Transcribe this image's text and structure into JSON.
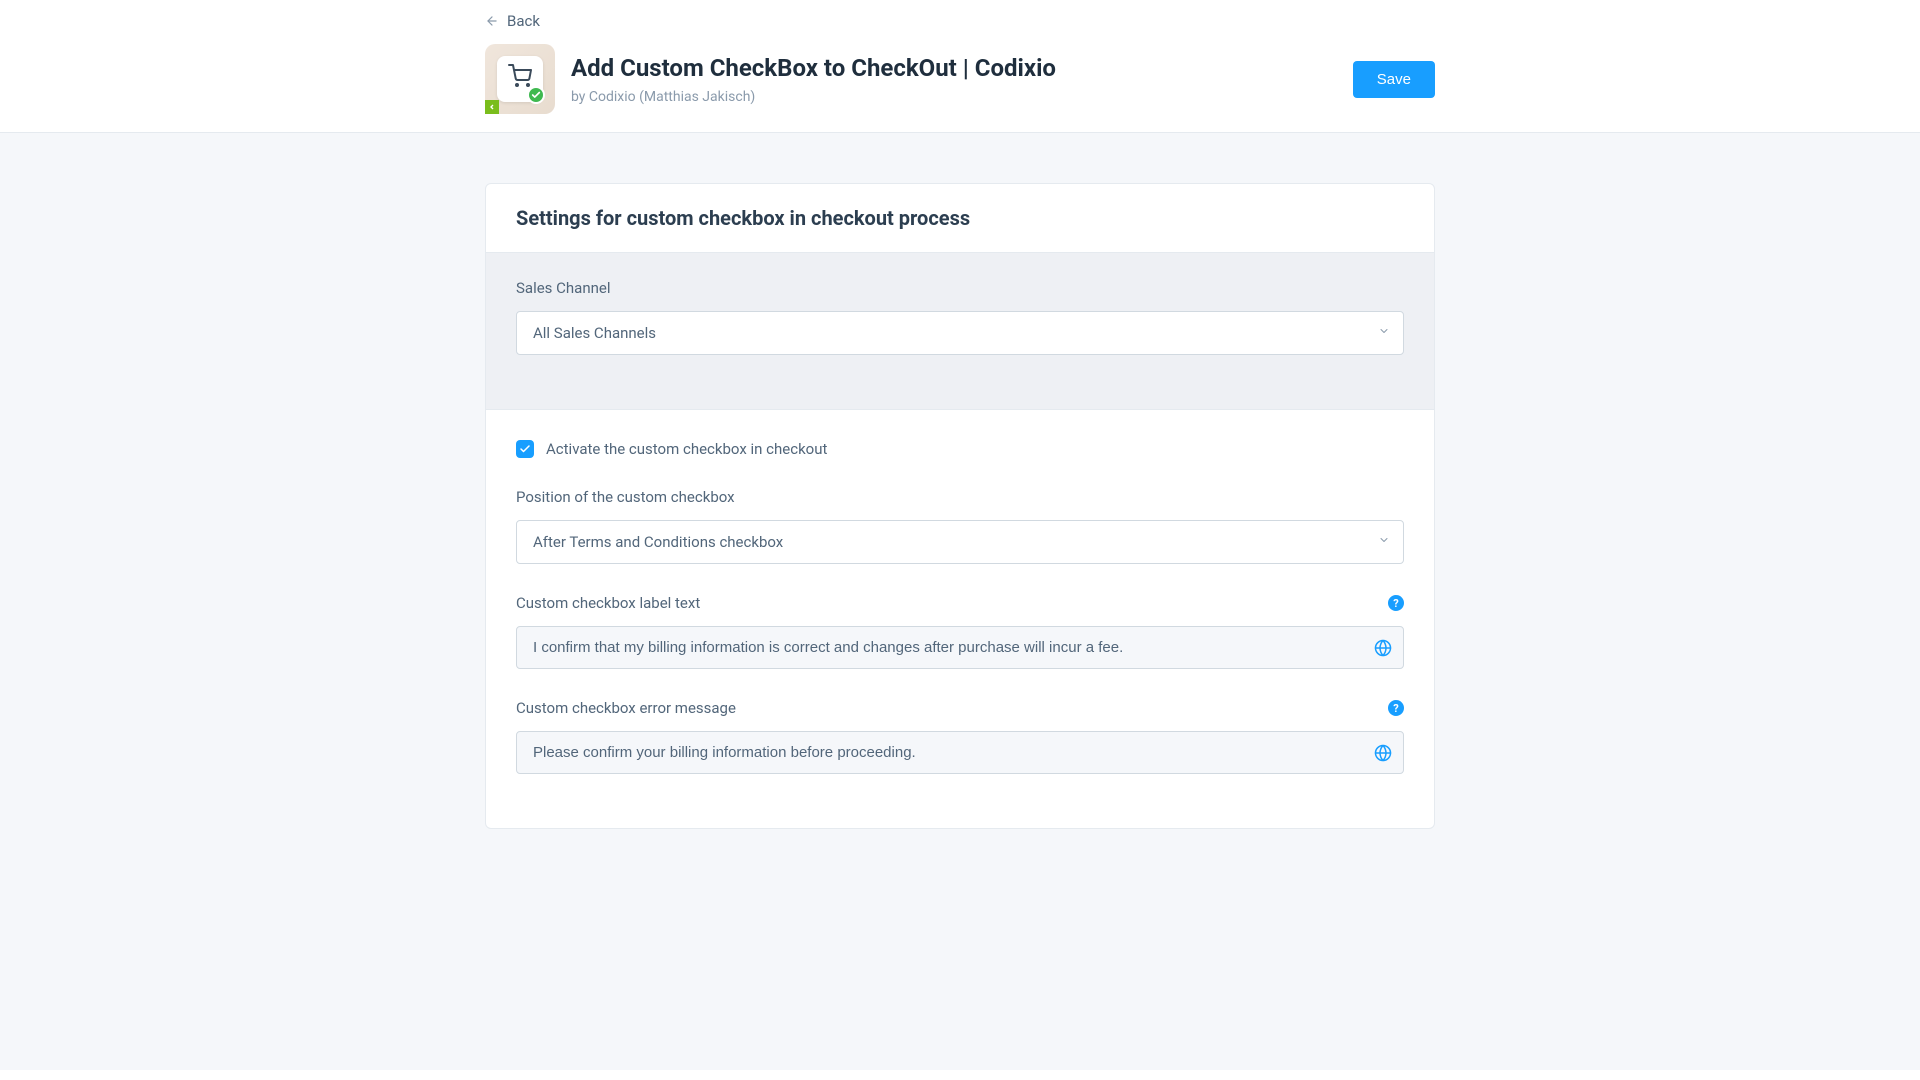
{
  "header": {
    "back_label": "Back",
    "title": "Add Custom CheckBox to CheckOut | Codixio",
    "byline": "by Codixio (Matthias Jakisch)",
    "save_label": "Save"
  },
  "card": {
    "title": "Settings for custom checkbox in checkout process"
  },
  "sales_channel": {
    "label": "Sales Channel",
    "value": "All Sales Channels"
  },
  "activate": {
    "checked": true,
    "label": "Activate the custom checkbox in checkout"
  },
  "position": {
    "label": "Position of the custom checkbox",
    "value": "After Terms and Conditions checkbox"
  },
  "label_text": {
    "label": "Custom checkbox label text",
    "value": "I confirm that my billing information is correct and changes after purchase will incur a fee."
  },
  "error_message": {
    "label": "Custom checkbox error message",
    "value": "Please confirm your billing information before proceeding."
  },
  "help_glyph": "?"
}
